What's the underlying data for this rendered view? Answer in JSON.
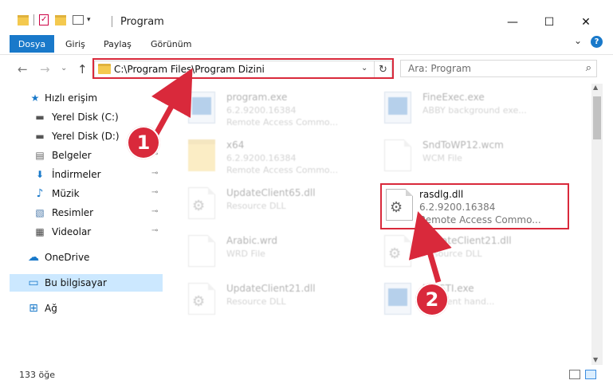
{
  "window": {
    "title": "Program",
    "minimize": "—",
    "maximize": "☐",
    "close": "✕"
  },
  "ribbon": {
    "tabs": [
      "Dosya",
      "Giriş",
      "Paylaş",
      "Görünüm"
    ],
    "expand": "⌄",
    "help": "?"
  },
  "nav": {
    "back": "←",
    "forward": "→",
    "recent": "⌄",
    "up": "↑"
  },
  "address": {
    "path": "C:\\Program Files\\Program Dizini",
    "dropdown": "⌄",
    "refresh": "↻"
  },
  "search": {
    "placeholder": "Ara: Program",
    "icon": "search-icon"
  },
  "sidebar": {
    "items": [
      {
        "label": "Hızlı erişim",
        "icon": "star-icon",
        "glyph": "★",
        "pinned": false
      },
      {
        "label": "Yerel Disk (C:)",
        "icon": "drive-icon",
        "glyph": "▬",
        "pinned": false
      },
      {
        "label": "Yerel Disk (D:)",
        "icon": "drive-icon",
        "glyph": "▬",
        "pinned": false
      },
      {
        "label": "Belgeler",
        "icon": "documents-icon",
        "glyph": "▤",
        "pinned": true
      },
      {
        "label": "İndirmeler",
        "icon": "download-icon",
        "glyph": "⬇",
        "pinned": true
      },
      {
        "label": "Müzik",
        "icon": "music-icon",
        "glyph": "♪",
        "pinned": true
      },
      {
        "label": "Resimler",
        "icon": "pictures-icon",
        "glyph": "▧",
        "pinned": true
      },
      {
        "label": "Videolar",
        "icon": "video-icon",
        "glyph": "▦",
        "pinned": true
      },
      {
        "label": "OneDrive",
        "icon": "cloud-icon",
        "glyph": "☁",
        "pinned": false
      },
      {
        "label": "Bu bilgisayar",
        "icon": "computer-icon",
        "glyph": "▭",
        "pinned": false,
        "selected": true
      },
      {
        "label": "Ağ",
        "icon": "network-icon",
        "glyph": "⊞",
        "pinned": false
      }
    ],
    "pin_glyph": "📌"
  },
  "files": [
    {
      "name": "program.exe",
      "line2": "6.2.9200.16384",
      "line3": "Remote Access Commo...",
      "icon": "exe-icon",
      "faded": true
    },
    {
      "name": "FineExec.exe",
      "line2": "ABBY background exe...",
      "line3": "",
      "icon": "window-icon",
      "faded": true
    },
    {
      "name": "x64",
      "line2": "6.2.9200.16384",
      "line3": "Remote Access Commo...",
      "icon": "folder-icon",
      "faded": true
    },
    {
      "name": "SndToWP12.wcm",
      "line2": "WCM File",
      "line3": "",
      "icon": "document-icon",
      "faded": true
    },
    {
      "name": "UpdateClient65.dll",
      "line2": "Resource DLL",
      "line3": "",
      "icon": "dll-icon",
      "faded": true
    },
    {
      "name": "rasdlg.dll",
      "line2": "6.2.9200.16384",
      "line3": "Remote Access Commo...",
      "icon": "dll-icon",
      "faded": false
    },
    {
      "name": "Arabic.wrd",
      "line2": "WRD File",
      "line3": "",
      "icon": "document-icon",
      "faded": true
    },
    {
      "name": "UpdateClient21.dll",
      "line2": "Resource DLL",
      "line3": "",
      "icon": "dll-icon",
      "faded": true
    },
    {
      "name": "UpdateClient21.dll",
      "line2": "Resource DLL",
      "line3": "",
      "icon": "dll-icon",
      "faded": true
    },
    {
      "name": "keySTI.exe",
      "line2": "ub event hand...",
      "line3": "",
      "icon": "window-icon",
      "faded": true
    }
  ],
  "status": {
    "count": "133 öğe"
  },
  "callouts": [
    "1",
    "2"
  ],
  "colors": {
    "accent": "#1979ca",
    "highlight": "#d9293b",
    "selected": "#cce8ff"
  }
}
